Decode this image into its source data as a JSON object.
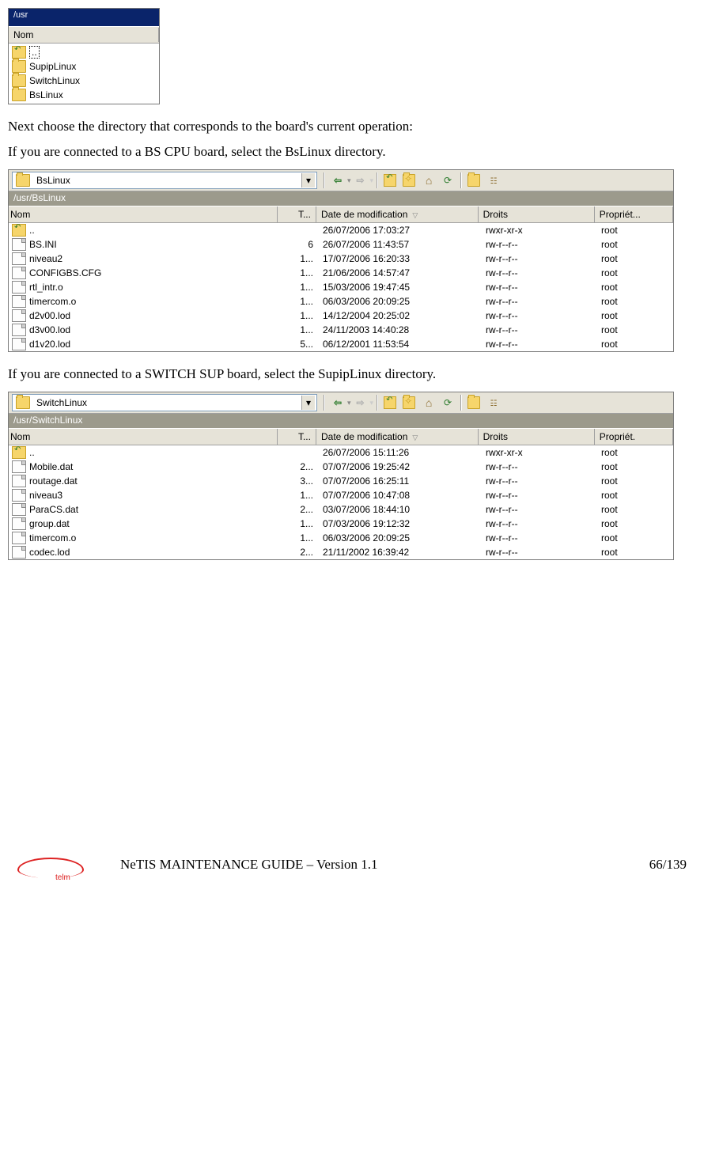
{
  "topshot": {
    "titlebar": "/usr",
    "header": "Nom",
    "rows": [
      {
        "type": "up",
        "label": ".."
      },
      {
        "type": "folder",
        "label": "SupipLinux"
      },
      {
        "type": "folder",
        "label": "SwitchLinux"
      },
      {
        "type": "folder",
        "label": "BsLinux"
      }
    ]
  },
  "text": {
    "p1": "Next choose the directory that corresponds to the board's current operation:",
    "p2": "If you are connected to a BS CPU board, select the BsLinux directory.",
    "p3": "If you are connected to a SWITCH SUP board, select the SupipLinux directory."
  },
  "columns": {
    "nom": "Nom",
    "size": "T...",
    "date": "Date de modification",
    "droits": "Droits",
    "propriet1": "Propriét...",
    "propriet2": "Propriét."
  },
  "shot2": {
    "dropdown": "BsLinux",
    "path": "/usr/BsLinux",
    "rows": [
      {
        "icon": "up",
        "name": "..",
        "size": "",
        "date": "26/07/2006 17:03:27",
        "perm": "rwxr-xr-x",
        "own": "root"
      },
      {
        "icon": "file",
        "name": "BS.INI",
        "size": "6",
        "date": "26/07/2006 11:43:57",
        "perm": "rw-r--r--",
        "own": "root"
      },
      {
        "icon": "file",
        "name": "niveau2",
        "size": "1...",
        "date": "17/07/2006 16:20:33",
        "perm": "rw-r--r--",
        "own": "root"
      },
      {
        "icon": "file",
        "name": "CONFIGBS.CFG",
        "size": "1...",
        "date": "21/06/2006 14:57:47",
        "perm": "rw-r--r--",
        "own": "root"
      },
      {
        "icon": "file",
        "name": "rtl_intr.o",
        "size": "1...",
        "date": "15/03/2006 19:47:45",
        "perm": "rw-r--r--",
        "own": "root"
      },
      {
        "icon": "file",
        "name": "timercom.o",
        "size": "1...",
        "date": "06/03/2006 20:09:25",
        "perm": "rw-r--r--",
        "own": "root"
      },
      {
        "icon": "file",
        "name": "d2v00.lod",
        "size": "1...",
        "date": "14/12/2004 20:25:02",
        "perm": "rw-r--r--",
        "own": "root"
      },
      {
        "icon": "file",
        "name": "d3v00.lod",
        "size": "1...",
        "date": "24/11/2003 14:40:28",
        "perm": "rw-r--r--",
        "own": "root"
      },
      {
        "icon": "file",
        "name": "d1v20.lod",
        "size": "5...",
        "date": "06/12/2001 11:53:54",
        "perm": "rw-r--r--",
        "own": "root"
      }
    ]
  },
  "shot3": {
    "dropdown": "SwitchLinux",
    "path": "/usr/SwitchLinux",
    "rows": [
      {
        "icon": "up",
        "name": "..",
        "size": "",
        "date": "26/07/2006 15:11:26",
        "perm": "rwxr-xr-x",
        "own": "root"
      },
      {
        "icon": "file",
        "name": "Mobile.dat",
        "size": "2...",
        "date": "07/07/2006 19:25:42",
        "perm": "rw-r--r--",
        "own": "root"
      },
      {
        "icon": "file",
        "name": "routage.dat",
        "size": "3...",
        "date": "07/07/2006 16:25:11",
        "perm": "rw-r--r--",
        "own": "root"
      },
      {
        "icon": "file",
        "name": "niveau3",
        "size": "1...",
        "date": "07/07/2006 10:47:08",
        "perm": "rw-r--r--",
        "own": "root"
      },
      {
        "icon": "file",
        "name": "ParaCS.dat",
        "size": "2...",
        "date": "03/07/2006 18:44:10",
        "perm": "rw-r--r--",
        "own": "root"
      },
      {
        "icon": "file",
        "name": "group.dat",
        "size": "1...",
        "date": "07/03/2006 19:12:32",
        "perm": "rw-r--r--",
        "own": "root"
      },
      {
        "icon": "file",
        "name": "timercom.o",
        "size": "1...",
        "date": "06/03/2006 20:09:25",
        "perm": "rw-r--r--",
        "own": "root"
      },
      {
        "icon": "file",
        "name": "codec.lod",
        "size": "2...",
        "date": "21/11/2002 16:39:42",
        "perm": "rw-r--r--",
        "own": "root"
      }
    ]
  },
  "footer": {
    "logo": "telm",
    "title": "NeTIS MAINTENANCE GUIDE – Version 1.1",
    "page": "66/139"
  }
}
